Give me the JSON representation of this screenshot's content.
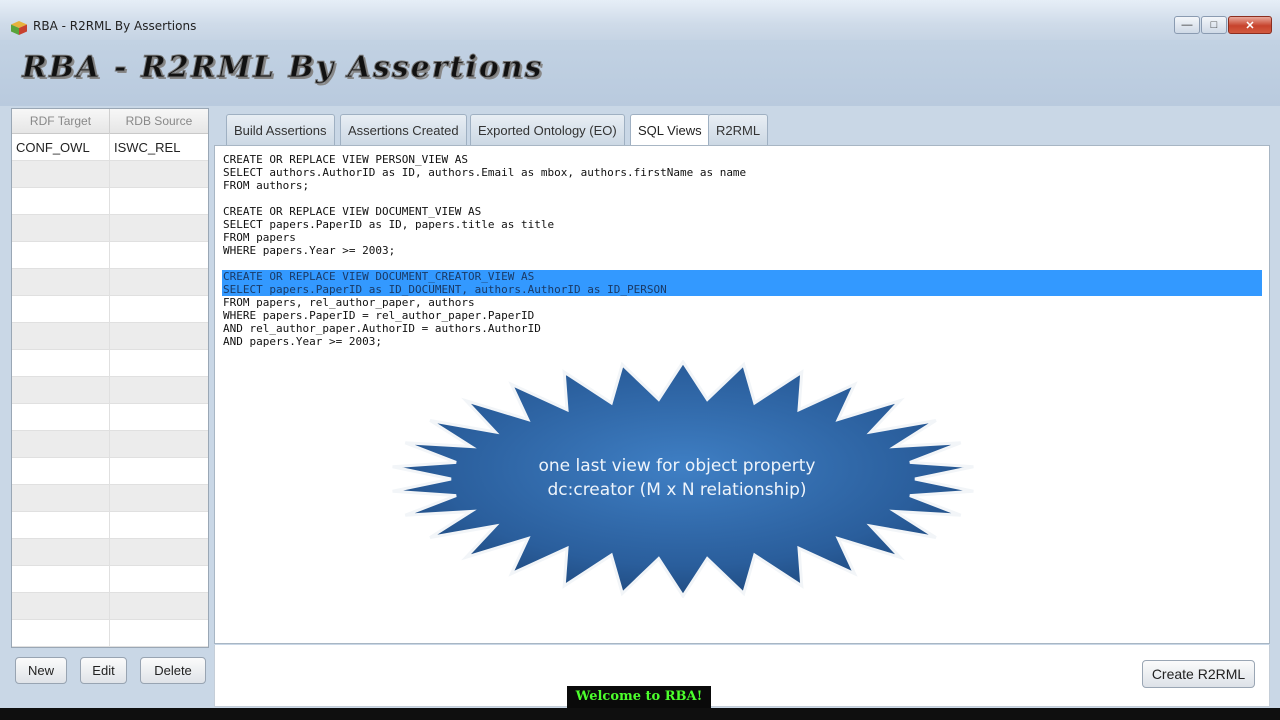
{
  "window": {
    "title": "RBA - R2RML By Assertions",
    "controls": {
      "minimize": "—",
      "maximize": "□",
      "close": "✕"
    }
  },
  "banner": {
    "text": "RBA - R2RML By Assertions"
  },
  "left_grid": {
    "columns": [
      "RDF Target",
      "RDB Source"
    ],
    "rows": [
      [
        "CONF_OWL",
        "ISWC_REL"
      ]
    ]
  },
  "left_buttons": {
    "new": "New",
    "edit": "Edit",
    "delete": "Delete"
  },
  "tabs": [
    "Build Assertions",
    "Assertions Created",
    "Exported Ontology (EO)",
    "SQL Views",
    "R2RML"
  ],
  "active_tab": "SQL Views",
  "sql_lines": [
    "CREATE OR REPLACE VIEW PERSON_VIEW AS",
    "SELECT authors.AuthorID as ID, authors.Email as mbox, authors.firstName as name",
    "FROM authors;",
    "",
    "CREATE OR REPLACE VIEW DOCUMENT_VIEW AS",
    "SELECT papers.PaperID as ID, papers.title as title",
    "FROM papers",
    "WHERE papers.Year >= 2003;",
    "",
    "CREATE OR REPLACE VIEW DOCUMENT_CREATOR_VIEW AS",
    "SELECT papers.PaperID as ID_DOCUMENT, authors.AuthorID as ID_PERSON",
    "FROM papers, rel_author_paper, authors",
    "WHERE papers.PaperID = rel_author_paper.PaperID",
    "AND rel_author_paper.AuthorID = authors.AuthorID",
    "AND papers.Year >= 2003;"
  ],
  "annotation": {
    "line1": "one last view for object property",
    "line2": "dc:creator (M x N relationship)"
  },
  "create_button": "Create R2RML",
  "caption": "Welcome to RBA!",
  "colors": {
    "selection": "#3399ff",
    "starburst": "#2f67a6",
    "caption_text": "#4cff2c"
  }
}
